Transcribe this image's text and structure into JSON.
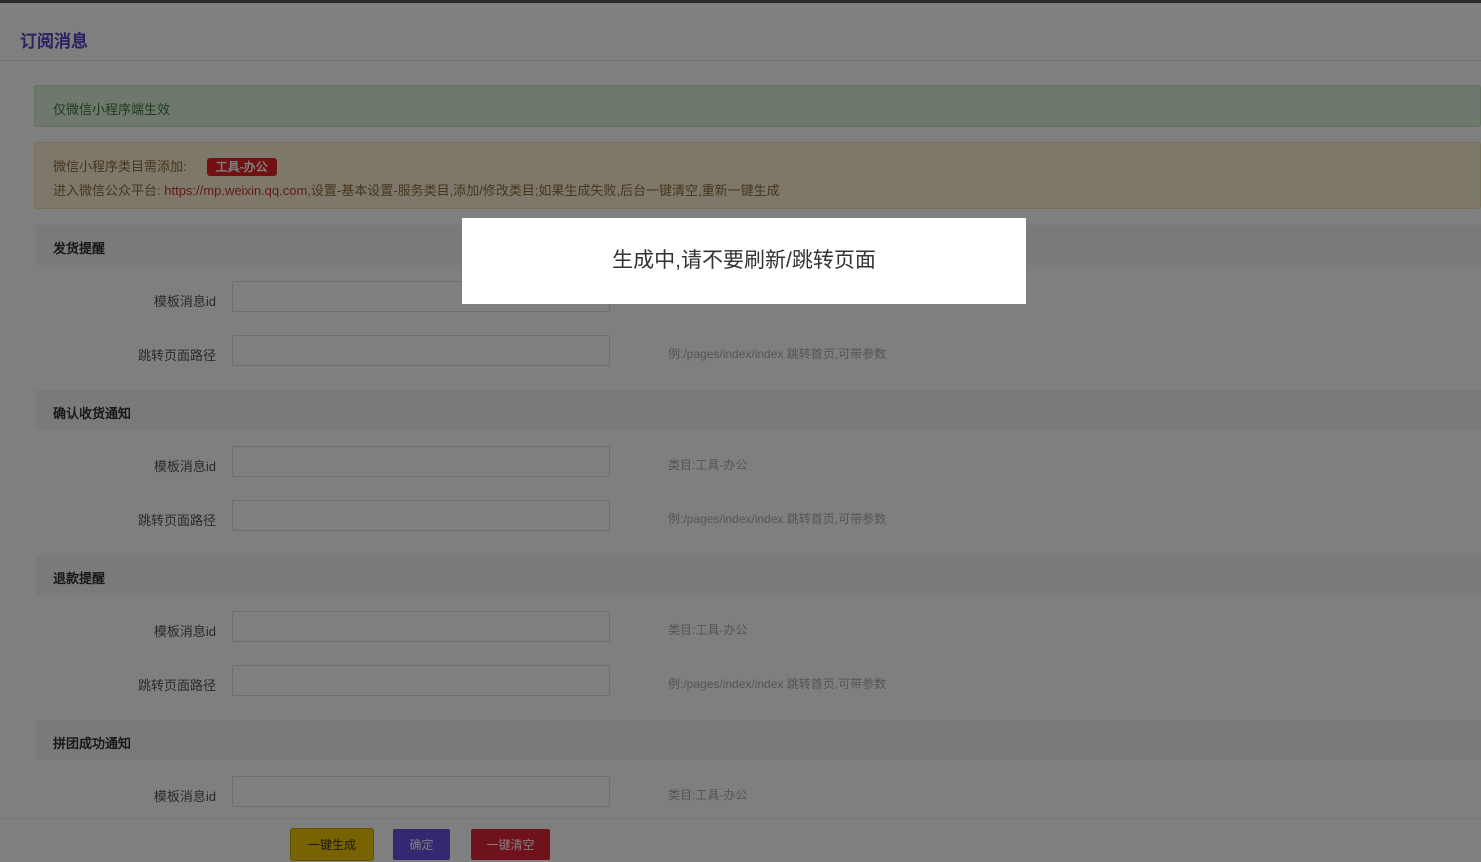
{
  "header": {
    "title": "订阅消息"
  },
  "notice_success": "仅微信小程序端生效",
  "notice_warning": {
    "line1_prefix": "微信小程序类目需添加:",
    "tag": "工具-办公",
    "line2_prefix": "进入微信公众平台:",
    "link": "https://mp.weixin.qq.com",
    "line2_suffix": ",设置-基本设置-服务类目,添加/修改类目;如果生成失败,后台一键清空,重新一键生成"
  },
  "labels": {
    "template_id": "模板消息id",
    "jump_path": "跳转页面路径"
  },
  "help": {
    "category": "类目:工具-办公",
    "path_example": "例:/pages/index/index 跳转首页,可带参数"
  },
  "sections": [
    {
      "title": "发货提醒"
    },
    {
      "title": "确认收货通知"
    },
    {
      "title": "退款提醒"
    },
    {
      "title": "拼团成功通知"
    }
  ],
  "buttons": {
    "generate": "一键生成",
    "confirm": "确定",
    "clear": "一键清空"
  },
  "modal": {
    "message": "生成中,请不要刷新/跳转页面"
  }
}
